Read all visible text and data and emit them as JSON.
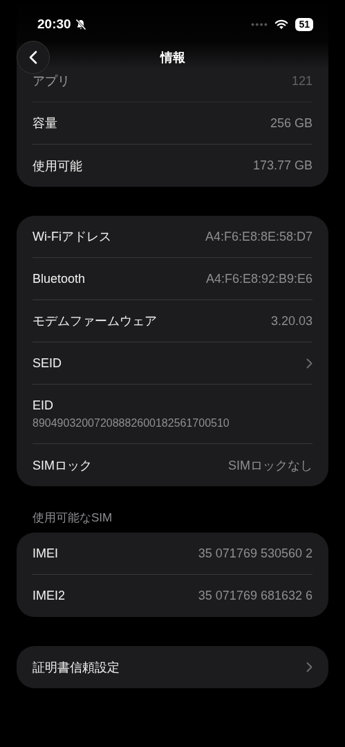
{
  "status_bar": {
    "time": "20:30",
    "silent": true,
    "battery": "51"
  },
  "nav": {
    "title": "情報"
  },
  "groups": [
    {
      "cut_top": true,
      "rows": [
        {
          "kind": "value",
          "label": "アプリ",
          "value": "121",
          "faded": true
        },
        {
          "kind": "value",
          "label": "容量",
          "value": "256 GB",
          "faded": false
        },
        {
          "kind": "value",
          "label": "使用可能",
          "value": "173.77 GB",
          "faded": false
        }
      ]
    },
    {
      "cut_top": false,
      "rows": [
        {
          "kind": "value",
          "label": "Wi-Fiアドレス",
          "value": "A4:F6:E8:8E:58:D7",
          "faded": false
        },
        {
          "kind": "value",
          "label": "Bluetooth",
          "value": "A4:F6:E8:92:B9:E6",
          "faded": false
        },
        {
          "kind": "value",
          "label": "モデムファームウェア",
          "value": "3.20.03",
          "faded": false
        },
        {
          "kind": "link",
          "label": "SEID",
          "faded": false
        },
        {
          "kind": "stacked",
          "label": "EID",
          "value": "89049032007208882600182561700510",
          "faded": false
        },
        {
          "kind": "value",
          "label": "SIMロック",
          "value": "SIMロックなし",
          "faded": false
        }
      ]
    },
    {
      "header": "使用可能なSIM",
      "cut_top": false,
      "rows": [
        {
          "kind": "value",
          "label": "IMEI",
          "value": "35 071769 530560 2",
          "faded": false
        },
        {
          "kind": "value",
          "label": "IMEI2",
          "value": "35 071769 681632 6",
          "faded": false
        }
      ]
    },
    {
      "cut_top": false,
      "rows": [
        {
          "kind": "link",
          "label": "証明書信頼設定",
          "faded": false
        }
      ]
    }
  ]
}
